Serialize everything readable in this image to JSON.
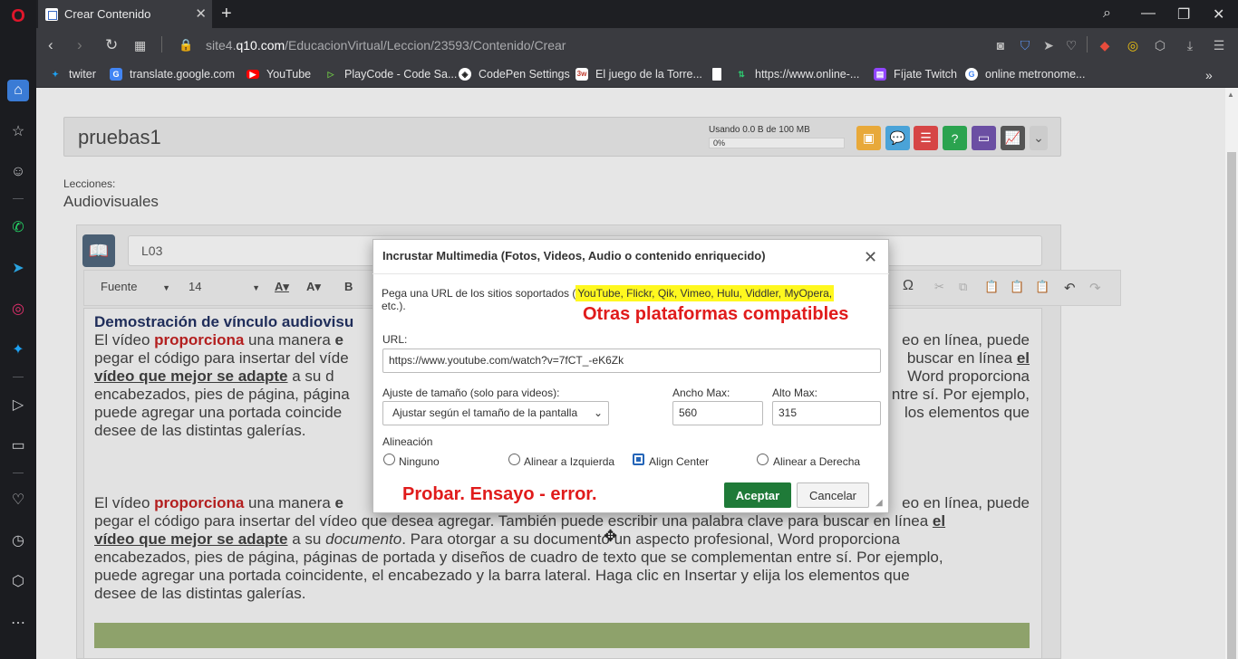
{
  "browser": {
    "tab_title": "Crear Contenido",
    "url_prefix": "site4.",
    "url_domain": "q10.com",
    "url_path": "/EducacionVirtual/Leccion/23593/Contenido/Crear"
  },
  "bookmarks": [
    {
      "label": "twiter",
      "icon": "twitter-icon",
      "color": "#1da1f2"
    },
    {
      "label": "translate.google.com",
      "icon": "translate-icon",
      "color": "#4285f4"
    },
    {
      "label": "YouTube",
      "icon": "youtube-icon",
      "color": "#ff0000"
    },
    {
      "label": "PlayCode - Code Sa...",
      "icon": "playcode-icon",
      "color": "#6bbe45"
    },
    {
      "label": "CodePen Settings",
      "icon": "codepen-icon",
      "color": "#222222"
    },
    {
      "label": "El juego de la Torre...",
      "icon": "3w-icon",
      "color": "#c0392b"
    },
    {
      "label": "https://www.online-...",
      "icon": "arrows-icon",
      "color": "#2ecc71"
    },
    {
      "label": "Fíjate Twitch",
      "icon": "twitch-icon",
      "color": "#9146ff"
    },
    {
      "label": "online metronome...",
      "icon": "google-icon",
      "color": "#ffffff"
    }
  ],
  "page": {
    "course_title": "pruebas1",
    "usage_text": "Usando 0.0 B de 100 MB",
    "usage_percent": "0%",
    "lecciones_label": "Lecciones:",
    "lecciones_value": "Audiovisuales",
    "lesson_code": "L03"
  },
  "toolbar": {
    "font_label": "Fuente",
    "size_label": "14",
    "bold_label": "B",
    "omega_label": "Ω"
  },
  "editor": {
    "heading": "Demostración de vínculo audiovisu",
    "p1_start": "El vídeo ",
    "p1_red": "proporciona",
    "p1_mid": " una manera ",
    "p1_end_right": "eo en línea, puede",
    "p1_line2_left": "pegar el código para insertar del víde",
    "p1_line2_right": " buscar en línea ",
    "p1_line2_ul": "el",
    "p1_line3_ul": "vídeo que mejor se adapte",
    "p1_line3_mid": " a su d",
    "p1_line3_right": "Word proporciona",
    "p1_line4_left": "encabezados, pies de página, página",
    "p1_line4_right": "ntre sí. Por ejemplo,",
    "p1_line5_left": "puede agregar una portada coincide",
    "p1_line5_right": "los elementos que",
    "p1_line6": "desee de las distintas galerías.",
    "p2_line1_right": "eo en línea, puede",
    "p2_line2": "pegar el código para insertar del vídeo que desea agregar. También puede escribir una palabra clave para buscar en línea ",
    "p2_line3_mid": " a su ",
    "p2_line3_italic": "documento",
    "p2_line3_rest": ". Para otorgar a su documento un aspecto profesional, Word proporciona",
    "p2_line4": "encabezados, pies de página, páginas de portada y diseños de cuadro de texto que se complementan entre sí. Por ejemplo,",
    "p2_line5": "puede agregar una portada coincidente, el encabezado y la barra lateral. Haga clic en Insertar y elija los elementos que",
    "p2_line6": "desee de las distintas galerías."
  },
  "modal": {
    "title": "Incrustar Multimedia (Fotos, Videos, Audio o contenido enriquecido)",
    "desc_start": "Pega una URL de los sitios soportados (",
    "desc_highlight": "YouTube, Flickr, Qik, Vimeo, Hulu, Viddler, MyOpera,",
    "desc_end": "etc.).",
    "annotation_platforms": "Otras plataformas compatibles",
    "url_label": "URL:",
    "url_value": "https://www.youtube.com/watch?v=7fCT_-eK6Zk",
    "resize_label": "Ajuste de tamaño (solo para videos):",
    "resize_value": "Ajustar según el tamaño de la pantalla",
    "width_label": "Ancho Max:",
    "width_value": "560",
    "height_label": "Alto Max:",
    "height_value": "315",
    "align_label": "Alineación",
    "align_options": [
      "Ninguno",
      "Alinear a Izquierda",
      "Align Center",
      "Alinear a Derecha"
    ],
    "annotation_trial": "Probar. Ensayo - error.",
    "accept_label": "Aceptar",
    "cancel_label": "Cancelar"
  }
}
